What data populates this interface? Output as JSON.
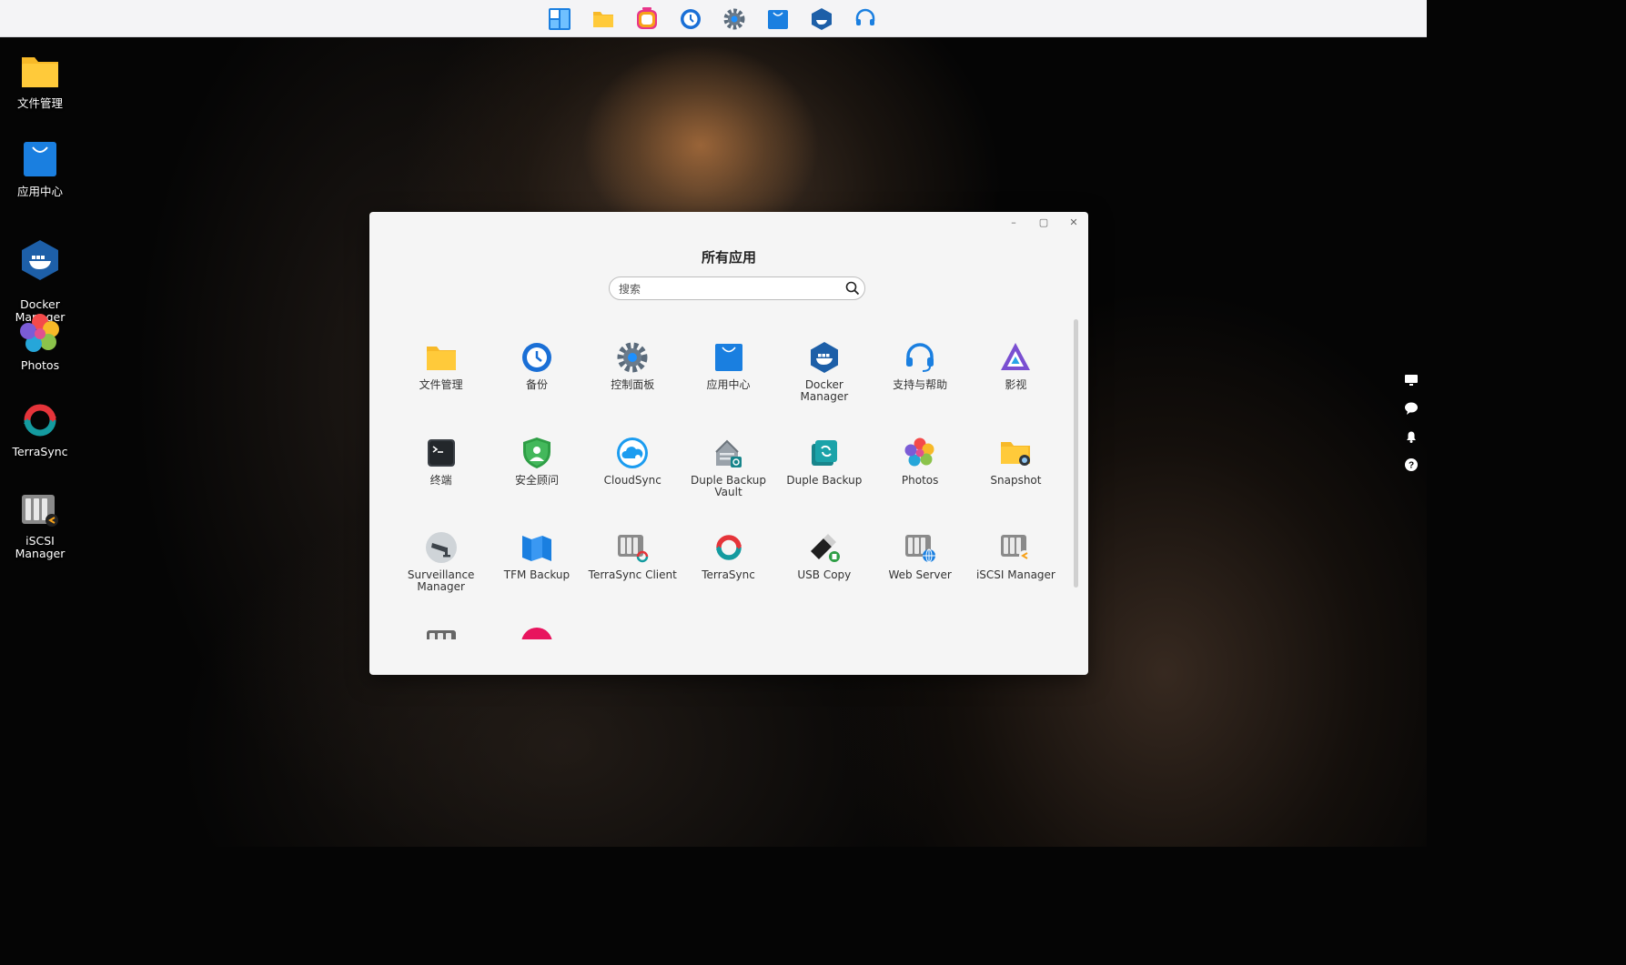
{
  "taskbar": {
    "items": [
      {
        "name": "start-menu-icon"
      },
      {
        "name": "file-manager-icon"
      },
      {
        "name": "media-icon"
      },
      {
        "name": "backup-icon"
      },
      {
        "name": "settings-icon"
      },
      {
        "name": "app-center-icon"
      },
      {
        "name": "docker-icon"
      },
      {
        "name": "support-icon"
      }
    ]
  },
  "desktop": {
    "icons": [
      {
        "label": "文件管理",
        "icon": "folder-icon"
      },
      {
        "label": "应用中心",
        "icon": "app-center-icon"
      },
      {
        "label": "Docker\nManager",
        "icon": "docker-icon"
      },
      {
        "label": "Photos",
        "icon": "photos-icon"
      },
      {
        "label": "TerraSync",
        "icon": "terrasync-icon"
      },
      {
        "label": "iSCSI Manager",
        "icon": "iscsi-icon"
      }
    ]
  },
  "window": {
    "title": "所有应用",
    "controls": {
      "minimize": "–",
      "maximize": "▢",
      "close": "✕"
    },
    "search": {
      "placeholder": "搜索",
      "value": ""
    },
    "apps": [
      {
        "label": "文件管理",
        "icon": "folder-icon"
      },
      {
        "label": "备份",
        "icon": "backup-clock-icon"
      },
      {
        "label": "控制面板",
        "icon": "gear-icon"
      },
      {
        "label": "应用中心",
        "icon": "shopping-bag-icon"
      },
      {
        "label": "Docker Manager",
        "icon": "docker-icon"
      },
      {
        "label": "支持与帮助",
        "icon": "headset-icon"
      },
      {
        "label": "影视",
        "icon": "media-triangle-icon"
      },
      {
        "label": "终端",
        "icon": "terminal-icon"
      },
      {
        "label": "安全顾问",
        "icon": "shield-icon"
      },
      {
        "label": "CloudSync",
        "icon": "cloud-icon"
      },
      {
        "label": "Duple Backup Vault",
        "icon": "vault-house-icon"
      },
      {
        "label": "Duple Backup",
        "icon": "duple-backup-icon"
      },
      {
        "label": "Photos",
        "icon": "photos-icon"
      },
      {
        "label": "Snapshot",
        "icon": "snapshot-folder-icon"
      },
      {
        "label": "Surveillance Manager",
        "icon": "camera-icon"
      },
      {
        "label": "TFM Backup",
        "icon": "map-book-icon"
      },
      {
        "label": "TerraSync Client",
        "icon": "nas-sync-icon"
      },
      {
        "label": "TerraSync",
        "icon": "terrasync-icon"
      },
      {
        "label": "USB Copy",
        "icon": "usb-drive-icon"
      },
      {
        "label": "Web Server",
        "icon": "nas-globe-icon"
      },
      {
        "label": "iSCSI Manager",
        "icon": "iscsi-icon"
      },
      {
        "label": "",
        "icon": "nas-icon"
      },
      {
        "label": "",
        "icon": "pink-circle-icon"
      }
    ]
  },
  "side_tools": [
    {
      "name": "display-icon"
    },
    {
      "name": "message-icon"
    },
    {
      "name": "bell-icon"
    },
    {
      "name": "help-icon"
    }
  ],
  "colors": {
    "folder": "#f7b928",
    "blue": "#1a7fe0",
    "docker": "#1d5fa8",
    "red": "#e5343a",
    "teal": "#149ba0"
  }
}
